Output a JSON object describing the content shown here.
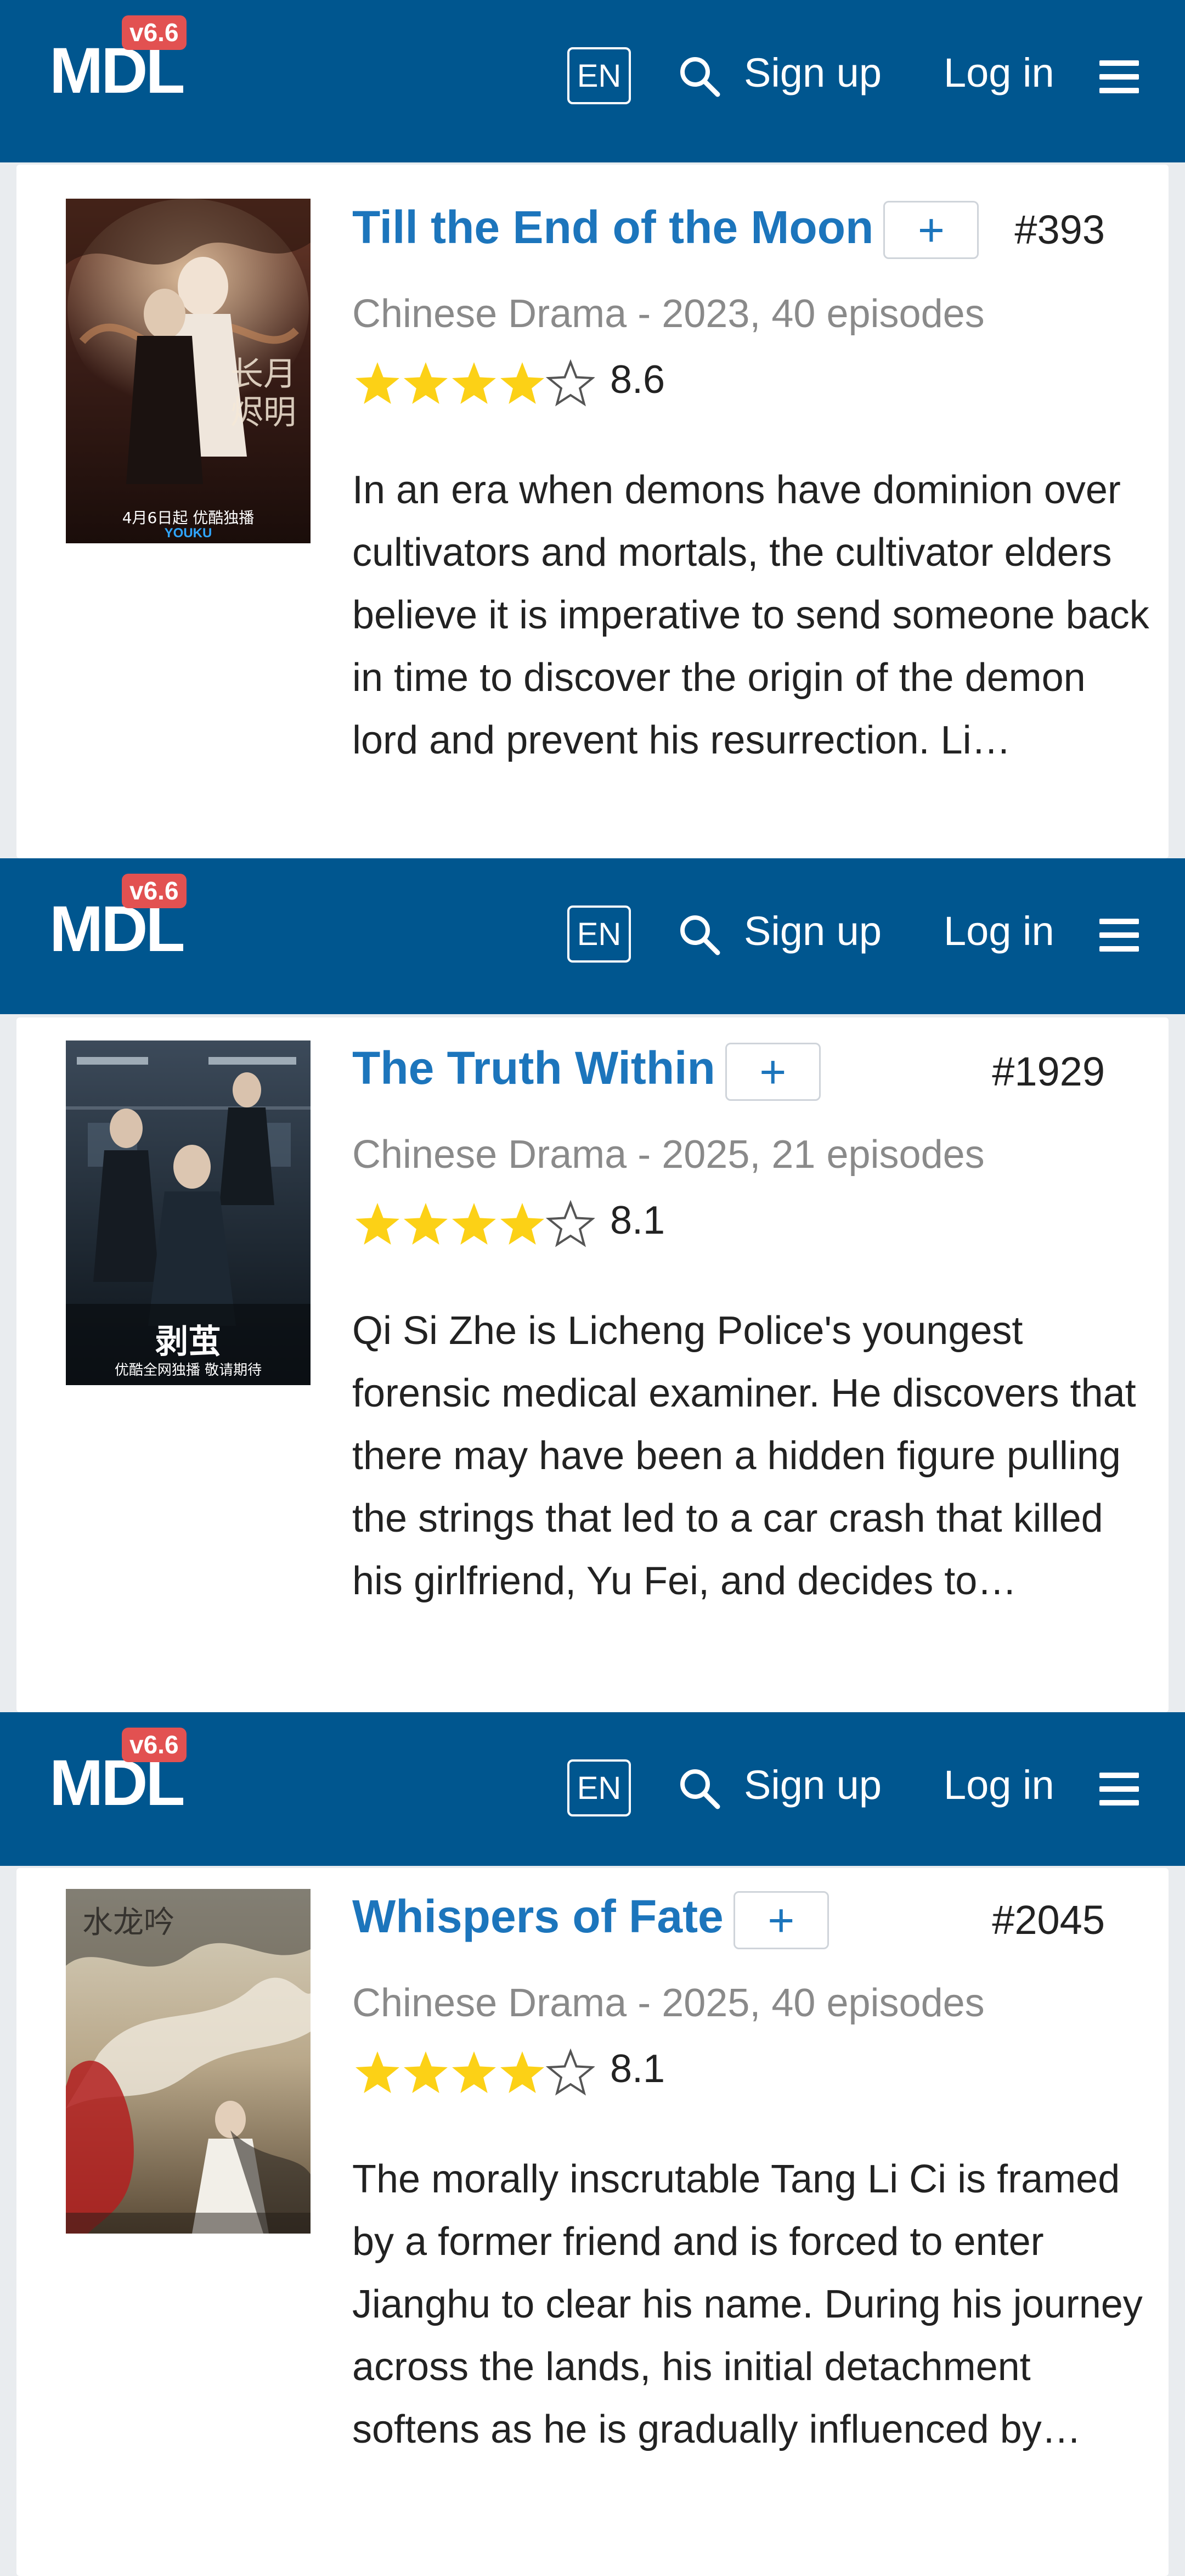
{
  "nav": {
    "logo": "MDL",
    "version": "v6.6",
    "lang": "EN",
    "signup": "Sign up",
    "login": "Log in"
  },
  "colors": {
    "nav_bg": "#00568f",
    "badge": "#e25151",
    "title": "#1c75bc",
    "star": "#fcd116"
  },
  "items": [
    {
      "title": "Till the End of the Moon",
      "add_label": "+",
      "rank": "#393",
      "meta": "Chinese Drama - 2023, 40 episodes",
      "rating": 8.6,
      "rating_text": "8.6",
      "stars_filled": 4,
      "synopsis": "In an era when demons have dominion over cultivators and mortals, the cultivator elders believe it is imperative to send someone back in time to discover the origin of the demon lord and prevent his resurrection. Li…",
      "poster_caption": "4月6日起 优酷独播",
      "poster_logo": "YOUKU"
    },
    {
      "title": "The Truth Within",
      "add_label": "+",
      "rank": "#1929",
      "meta": "Chinese Drama - 2025, 21 episodes",
      "rating": 8.1,
      "rating_text": "8.1",
      "stars_filled": 4,
      "synopsis": "Qi Si Zhe is Licheng Police's youngest forensic medical examiner. He discovers that there may have been a hidden figure pulling the strings that led to a car crash that killed his girlfriend, Yu Fei, and decides to…",
      "poster_caption": "剥茧",
      "poster_sub": "优酷全网独播 敬请期待"
    },
    {
      "title": "Whispers of Fate",
      "add_label": "+",
      "rank": "#2045",
      "meta": "Chinese Drama - 2025, 40 episodes",
      "rating": 8.1,
      "rating_text": "8.1",
      "stars_filled": 4,
      "synopsis": "The morally inscrutable Tang Li Ci is framed by a former friend and is forced to enter Jianghu to clear his name. During his journey across the lands, his initial detachment softens as he is gradually influenced by…",
      "poster_caption": "水龙吟"
    }
  ]
}
